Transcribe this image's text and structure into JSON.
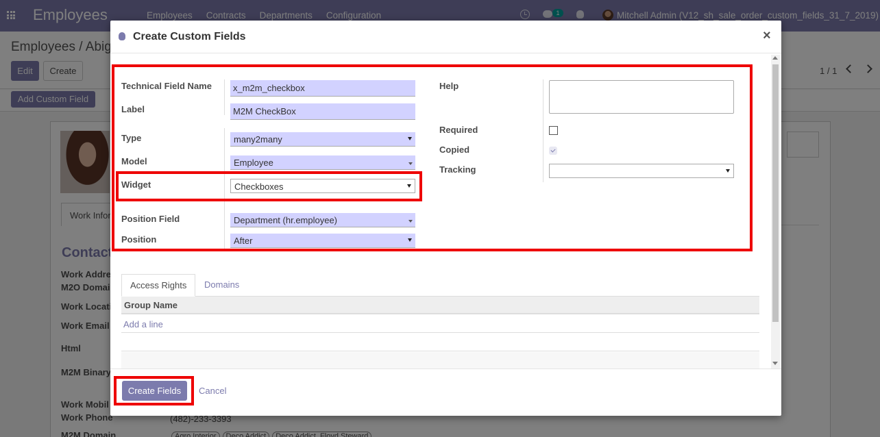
{
  "navbar": {
    "app_title": "Employees",
    "menu": [
      "Employees",
      "Contracts",
      "Departments",
      "Configuration"
    ],
    "chat_badge": "1",
    "user": "Mitchell Admin (V12_sh_sale_order_custom_fields_31_7_2019)"
  },
  "control_panel": {
    "breadcrumb": "Employees / Abiga",
    "edit_label": "Edit",
    "create_label": "Create",
    "pager": "1 / 1",
    "add_custom_field_label": "Add Custom Field"
  },
  "background_form": {
    "tab_label": "Work Infor",
    "contact_heading": "Contact",
    "labels": [
      "Work Addre",
      "M2O Domai",
      "Work Locati",
      "Work Email",
      "Html",
      "M2M Binary",
      "Work Mobil",
      "Work Phone",
      "M2M Domain"
    ],
    "phone": "(482)-233-3393",
    "tags": [
      "Agro Interior",
      "Deco Addict",
      "Deco Addict, Floyd Steward"
    ]
  },
  "dialog": {
    "title": "Create Custom Fields",
    "close_glyph": "×",
    "fields": {
      "technical_name_label": "Technical Field Name",
      "technical_name_value": "x_m2m_checkbox",
      "label_label": "Label",
      "label_value": "M2M CheckBox",
      "type_label": "Type",
      "type_value": "many2many",
      "model_label": "Model",
      "model_value": "Employee",
      "widget_label": "Widget",
      "widget_value": "Checkboxes",
      "position_field_label": "Position Field",
      "position_field_value": "Department (hr.employee)",
      "position_label": "Position",
      "position_value": "After",
      "help_label": "Help",
      "help_value": "",
      "required_label": "Required",
      "required_checked": false,
      "copied_label": "Copied",
      "copied_checked": true,
      "tracking_label": "Tracking",
      "tracking_value": ""
    },
    "tabs": [
      "Access Rights",
      "Domains"
    ],
    "table": {
      "header": "Group Name",
      "add_line": "Add a line"
    },
    "footer": {
      "create_label": "Create Fields",
      "cancel_label": "Cancel"
    }
  },
  "colors": {
    "brand": "#7c7bad",
    "input_bg": "#d2d2ff",
    "highlight": "#e00000"
  }
}
